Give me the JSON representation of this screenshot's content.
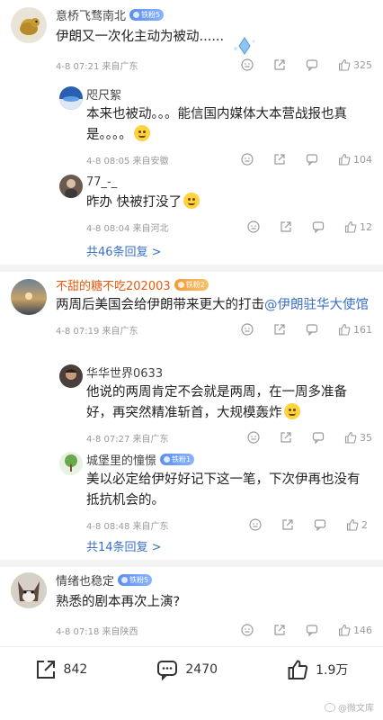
{
  "comments": [
    {
      "user": "意桥飞骛南北",
      "badge": "铁粉5",
      "text": "伊朗又一次化主动为被动......",
      "meta": "4-8 07:21 来自广东",
      "likes": "325",
      "replies": [
        {
          "user": "咫尺絮",
          "text": "本来也被动。。。能信国内媒体大本营战报也真是。。。。",
          "meta": "4-8 08:05 来自安徽",
          "likes": "104"
        },
        {
          "user": "77_-_",
          "text": "昨办 快被打没了",
          "meta": "4-8 08:04 来自河北",
          "likes": "12"
        }
      ],
      "more_replies": "共46条回复 >"
    },
    {
      "user": "不甜的糖不吃202003",
      "badge": "铁粉2",
      "text": "两周后美国会给伊朗带来更大的打击",
      "mention": "@伊朗驻华大使馆",
      "meta": "4-8 07:19 来自广东",
      "likes": "161",
      "replies": [
        {
          "user": "华华世界0633",
          "text": "他说的两周肯定不会就是两周，在一周多准备好，再突然精准斩首，大规模轰炸",
          "meta": "4-8 07:27 来自广东",
          "likes": "35"
        },
        {
          "user": "城堡里的憧憬",
          "badge": "铁粉1",
          "text": "美以必定给伊好好记下这一笔，下次伊再也没有抵抗机会的。",
          "meta": "4-8 08:48 来自广东",
          "likes": "2"
        }
      ],
      "more_replies": "共14条回复 >"
    },
    {
      "user": "情绪也稳定",
      "badge": "铁粉5",
      "text": "熟悉的剧本再次上演?",
      "meta": "4-8 07:18 来自陕西",
      "likes": "146"
    }
  ],
  "bottom_bar": {
    "share_count": "842",
    "comment_count": "2470",
    "like_count": "1.9万"
  },
  "watermark": "@微文库",
  "colors": {
    "link": "#3a6fc6",
    "username_highlight": "#e8590c",
    "meta": "#9a9a9a"
  }
}
